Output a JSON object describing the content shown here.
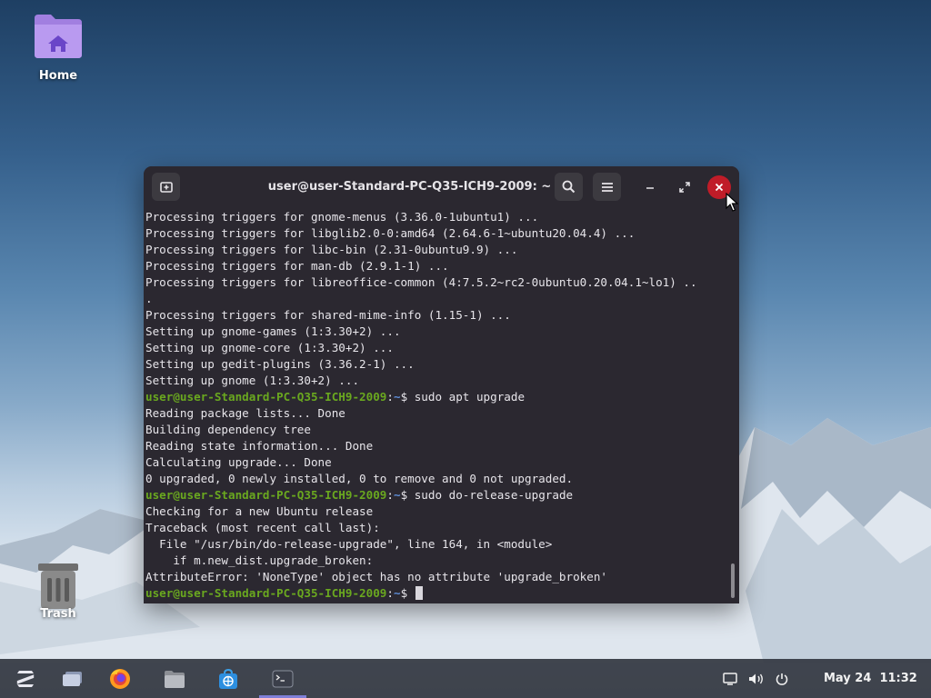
{
  "desktop": {
    "icons": [
      {
        "label": "Home"
      },
      {
        "label": "Trash"
      }
    ]
  },
  "terminal": {
    "title": "user@user-Standard-PC-Q35-ICH9-2009: ~",
    "prompt_user": "user@user-Standard-PC-Q35-ICH9-2009",
    "prompt_path": "~",
    "lines": [
      {
        "text": "Processing triggers for gnome-menus (3.36.0-1ubuntu1) ..."
      },
      {
        "text": "Processing triggers for libglib2.0-0:amd64 (2.64.6-1~ubuntu20.04.4) ..."
      },
      {
        "text": "Processing triggers for libc-bin (2.31-0ubuntu9.9) ..."
      },
      {
        "text": "Processing triggers for man-db (2.9.1-1) ..."
      },
      {
        "text": "Processing triggers for libreoffice-common (4:7.5.2~rc2-0ubuntu0.20.04.1~lo1) .."
      },
      {
        "text": "."
      },
      {
        "text": "Processing triggers for shared-mime-info (1.15-1) ..."
      },
      {
        "text": "Setting up gnome-games (1:3.30+2) ..."
      },
      {
        "text": "Setting up gnome-core (1:3.30+2) ..."
      },
      {
        "text": "Setting up gedit-plugins (3.36.2-1) ..."
      },
      {
        "text": "Setting up gnome (1:3.30+2) ..."
      },
      {
        "prompt": true,
        "cmd": "$ sudo apt upgrade"
      },
      {
        "text": "Reading package lists... Done"
      },
      {
        "text": "Building dependency tree"
      },
      {
        "text": "Reading state information... Done"
      },
      {
        "text": "Calculating upgrade... Done"
      },
      {
        "text": "0 upgraded, 0 newly installed, 0 to remove and 0 not upgraded."
      },
      {
        "prompt": true,
        "cmd": "$ sudo do-release-upgrade"
      },
      {
        "text": "Checking for a new Ubuntu release"
      },
      {
        "text": "Traceback (most recent call last):"
      },
      {
        "text": "  File \"/usr/bin/do-release-upgrade\", line 164, in <module>"
      },
      {
        "text": "    if m.new_dist.upgrade_broken:"
      },
      {
        "text": "AttributeError: 'NoneType' object has no attribute 'upgrade_broken'"
      },
      {
        "prompt": true,
        "cmd": "$ ",
        "cursor": true
      }
    ]
  },
  "taskbar": {
    "apps": [
      {
        "icon": "zorin-menu-icon"
      },
      {
        "icon": "workspaces-icon"
      },
      {
        "icon": "firefox-icon"
      },
      {
        "icon": "files-icon"
      },
      {
        "icon": "software-store-icon"
      },
      {
        "icon": "terminal-icon",
        "active": true
      }
    ],
    "tray": [
      {
        "icon": "display-icon"
      },
      {
        "icon": "volume-icon"
      },
      {
        "icon": "power-icon"
      }
    ],
    "clock": "May 24  11:32"
  },
  "colors": {
    "terminal_bg": "#2b2830",
    "prompt_user": "#6aa81f",
    "prompt_path": "#5f8ed8",
    "close_button": "#c01c28",
    "taskbar_active": "#7f7fd9"
  }
}
